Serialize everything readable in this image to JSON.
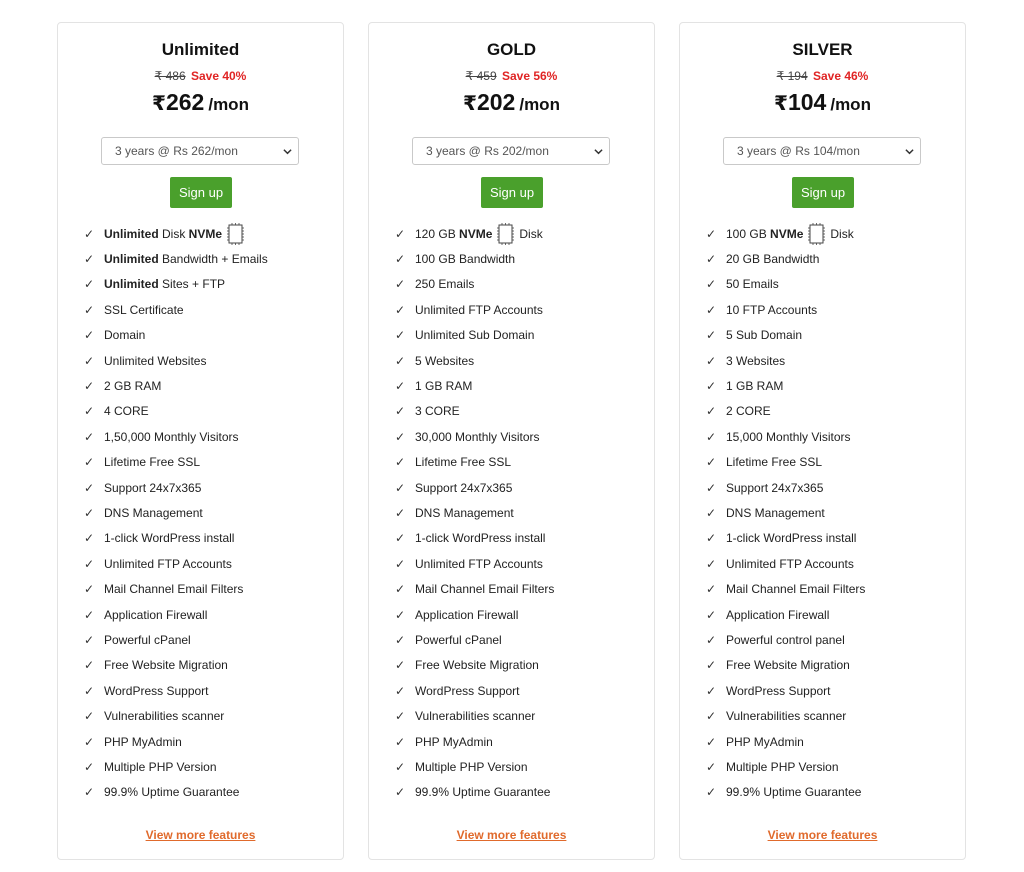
{
  "plans": [
    {
      "title": "Unlimited",
      "old_price": "₹ 486",
      "save": "Save 40%",
      "currency": "₹",
      "price": "262",
      "per": "/mon",
      "term": "3 years @ Rs 262/mon",
      "signup": "Sign up",
      "more": "View more features",
      "features": [
        {
          "bold": "Unlimited",
          "text": " Disk ",
          "bold2": "NVMe",
          "chip": true,
          "after": ""
        },
        {
          "bold": "Unlimited",
          "text": " Bandwidth + Emails"
        },
        {
          "bold": "Unlimited",
          "text": " Sites + FTP"
        },
        {
          "text": "SSL Certificate"
        },
        {
          "text": "Domain"
        },
        {
          "text": "Unlimited Websites"
        },
        {
          "text": "2 GB RAM"
        },
        {
          "text": "4 CORE"
        },
        {
          "text": "1,50,000 Monthly Visitors"
        },
        {
          "text": "Lifetime Free SSL"
        },
        {
          "text": "Support 24x7x365"
        },
        {
          "text": "DNS Management"
        },
        {
          "text": "1-click WordPress install"
        },
        {
          "text": "Unlimited FTP Accounts"
        },
        {
          "text": "Mail Channel Email Filters"
        },
        {
          "text": "Application Firewall"
        },
        {
          "text": "Powerful cPanel"
        },
        {
          "text": "Free Website Migration"
        },
        {
          "text": "WordPress Support"
        },
        {
          "text": "Vulnerabilities scanner"
        },
        {
          "text": "PHP MyAdmin"
        },
        {
          "text": "Multiple PHP Version"
        },
        {
          "text": "99.9% Uptime Guarantee"
        }
      ]
    },
    {
      "title": "GOLD",
      "old_price": "₹ 459",
      "save": "Save 56%",
      "currency": "₹",
      "price": "202",
      "per": "/mon",
      "term": "3 years @ Rs 202/mon",
      "signup": "Sign up",
      "more": "View more features",
      "features": [
        {
          "text": "120 GB ",
          "bold2": "NVMe",
          "chip": true,
          "after": "Disk"
        },
        {
          "text": "100 GB Bandwidth"
        },
        {
          "text": "250 Emails"
        },
        {
          "text": "Unlimited FTP Accounts"
        },
        {
          "text": "Unlimited Sub Domain"
        },
        {
          "text": "5 Websites"
        },
        {
          "text": "1 GB RAM"
        },
        {
          "text": "3 CORE"
        },
        {
          "text": "30,000 Monthly Visitors"
        },
        {
          "text": "Lifetime Free SSL"
        },
        {
          "text": "Support 24x7x365"
        },
        {
          "text": "DNS Management"
        },
        {
          "text": "1-click WordPress install"
        },
        {
          "text": "Unlimited FTP Accounts"
        },
        {
          "text": "Mail Channel Email Filters"
        },
        {
          "text": "Application Firewall"
        },
        {
          "text": "Powerful cPanel"
        },
        {
          "text": "Free Website Migration"
        },
        {
          "text": "WordPress Support"
        },
        {
          "text": "Vulnerabilities scanner"
        },
        {
          "text": "PHP MyAdmin"
        },
        {
          "text": "Multiple PHP Version"
        },
        {
          "text": "99.9% Uptime Guarantee"
        }
      ]
    },
    {
      "title": "SILVER",
      "old_price": "₹ 194",
      "save": "Save 46%",
      "currency": "₹",
      "price": "104",
      "per": "/mon",
      "term": "3 years @ Rs 104/mon",
      "signup": "Sign up",
      "more": "View more features",
      "features": [
        {
          "text": "100 GB ",
          "bold2": "NVMe",
          "chip": true,
          "after": "Disk"
        },
        {
          "text": "20 GB Bandwidth"
        },
        {
          "text": "50 Emails"
        },
        {
          "text": "10 FTP Accounts"
        },
        {
          "text": "5 Sub Domain"
        },
        {
          "text": "3 Websites"
        },
        {
          "text": "1 GB RAM"
        },
        {
          "text": "2 CORE"
        },
        {
          "text": "15,000 Monthly Visitors"
        },
        {
          "text": "Lifetime Free SSL"
        },
        {
          "text": "Support 24x7x365"
        },
        {
          "text": "DNS Management"
        },
        {
          "text": "1-click WordPress install"
        },
        {
          "text": "Unlimited FTP Accounts"
        },
        {
          "text": "Mail Channel Email Filters"
        },
        {
          "text": "Application Firewall"
        },
        {
          "text": "Powerful control panel"
        },
        {
          "text": "Free Website Migration"
        },
        {
          "text": "WordPress Support"
        },
        {
          "text": "Vulnerabilities scanner"
        },
        {
          "text": "PHP MyAdmin"
        },
        {
          "text": "Multiple PHP Version"
        },
        {
          "text": "99.9% Uptime Guarantee"
        }
      ]
    }
  ],
  "check_glyph": "✓",
  "chip_label": "NVMe",
  "icons": {
    "check": "check-icon",
    "chip": "nvme-chip-icon",
    "dropdown": "chevron-down-icon"
  },
  "colors": {
    "accent_green": "#4aa02c",
    "save_red": "#e02424",
    "link_orange": "#e06a2c"
  }
}
